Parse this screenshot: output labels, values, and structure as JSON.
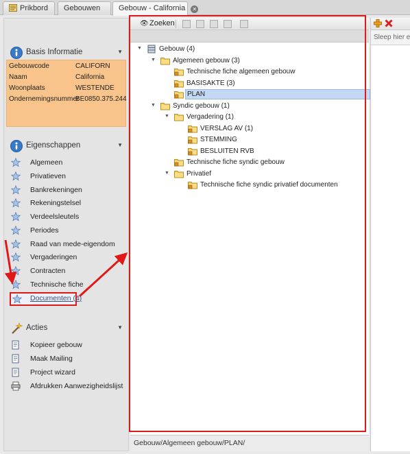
{
  "tabs": [
    {
      "label": "Prikbord",
      "icon": "bulletin-icon"
    },
    {
      "label": "Gebouwen"
    },
    {
      "label": "Gebouw - California",
      "active": true
    }
  ],
  "left": {
    "basis": {
      "title": "Basis Informatie",
      "rows": [
        {
          "key": "Gebouwcode",
          "value": "CALIFORN"
        },
        {
          "key": "Naam",
          "value": "California"
        },
        {
          "key": "Woonplaats",
          "value": "WESTENDE"
        },
        {
          "key": "Ondernemingsnummer",
          "value": "BE0850.375.244"
        }
      ]
    },
    "eigenschappen": {
      "title": "Eigenschappen",
      "items": [
        "Algemeen",
        "Privatieven",
        "Bankrekeningen",
        "Rekeningstelsel",
        "Verdeelsleutels",
        "Periodes",
        "Raad van mede-eigendom",
        "Vergaderingen",
        "Contracten",
        "Technische fiche",
        "Documenten (4)"
      ]
    },
    "acties": {
      "title": "Acties",
      "items": [
        "Kopieer gebouw",
        "Maak Mailing",
        "Project wizard",
        "Afdrukken Aanwezigheidslijst"
      ]
    }
  },
  "center": {
    "search_label": "Zoeken",
    "tree": [
      "Gebouw (4)",
      "Algemeen gebouw (3)",
      "Technische fiche algemeen gebouw",
      "BASISAKTE (3)",
      "PLAN",
      "Syndic gebouw (1)",
      "Vergadering (1)",
      "VERSLAG AV (1)",
      "STEMMING",
      "BESLUITEN RVB",
      "Technische fiche syndic gebouw",
      "Privatief",
      "Technische fiche syndic privatief documenten"
    ],
    "path": "Gebouw/Algemeen gebouw/PLAN/"
  },
  "right": {
    "drop_hint": "Sleep hier eer"
  },
  "colors": {
    "annotation_red": "#e01818",
    "info_bg": "#f9c48b",
    "selection": "#c3d8f2"
  }
}
